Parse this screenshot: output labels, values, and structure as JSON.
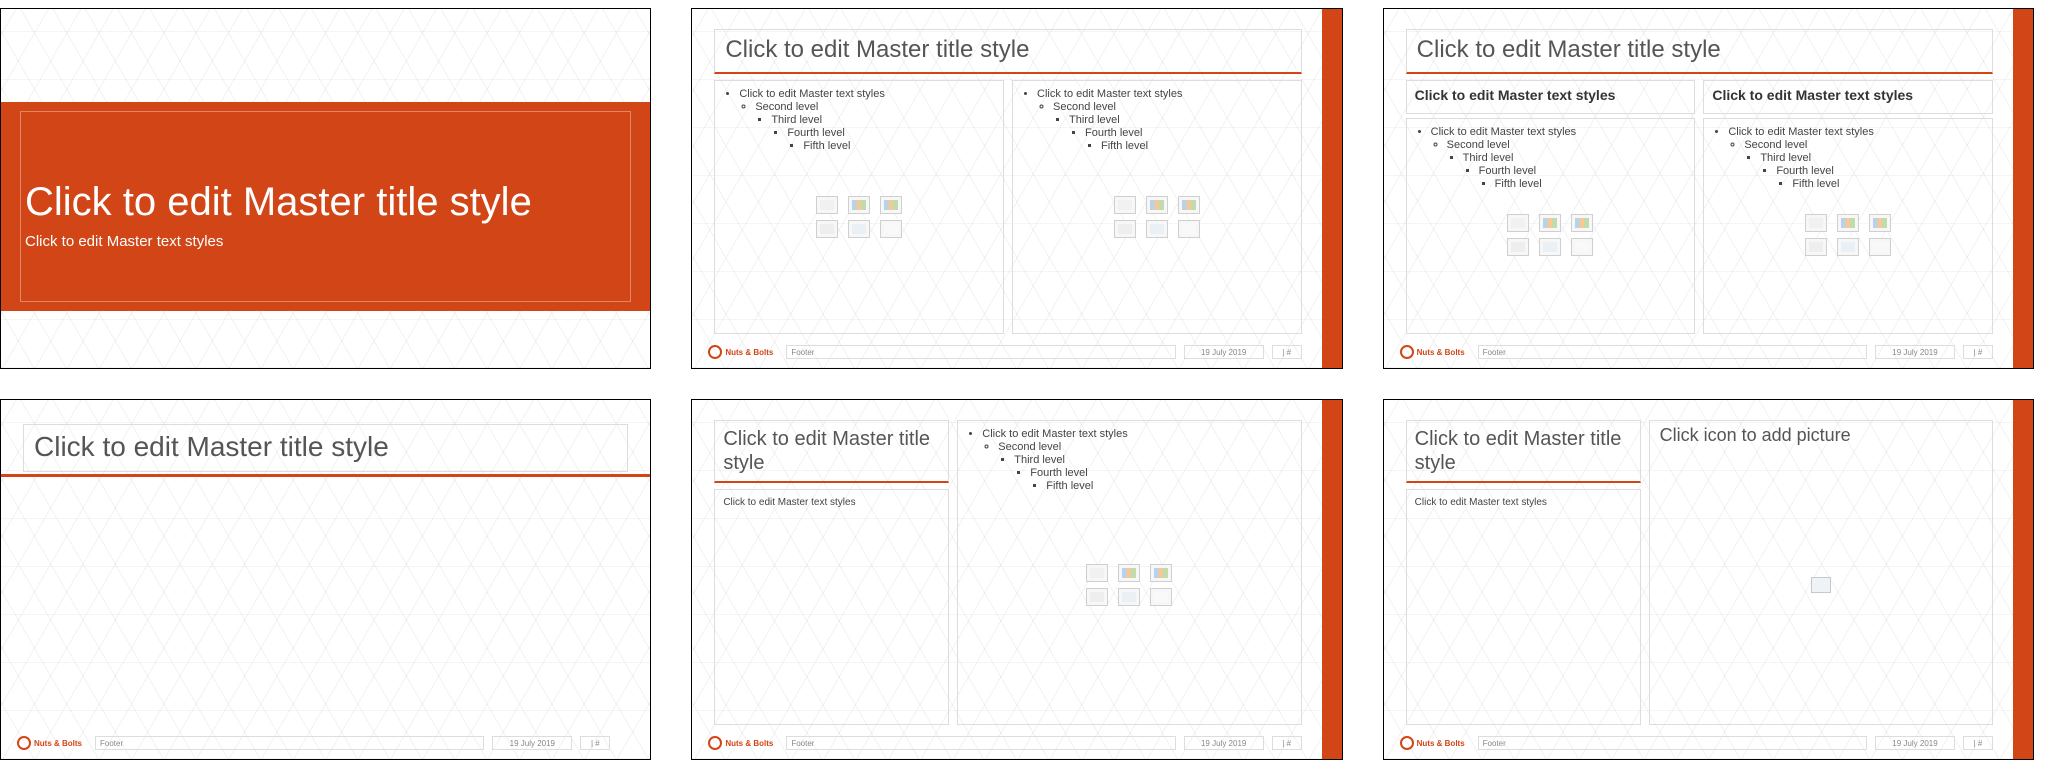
{
  "common": {
    "title_placeholder": "Click to edit Master title style",
    "text_placeholder": "Click to edit Master text styles",
    "levels": {
      "l2": "Second level",
      "l3": "Third level",
      "l4": "Fourth level",
      "l5": "Fifth level"
    },
    "footer": {
      "brand": "Nuts & Bolts",
      "label": "Footer",
      "date": "19 July 2019",
      "page": "| #"
    },
    "picture_placeholder": "Click icon to add picture"
  },
  "accent_color": "#d24517"
}
